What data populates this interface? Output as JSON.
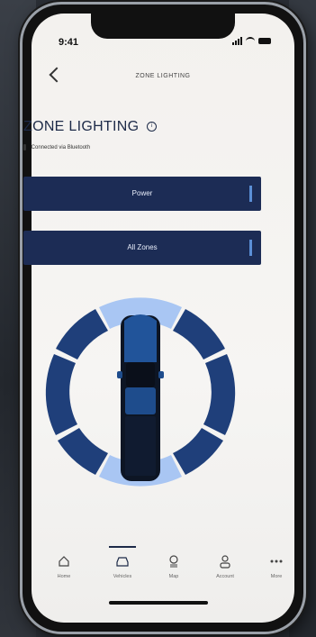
{
  "status": {
    "time": "9:41"
  },
  "header": {
    "title": "ZONE LIGHTING"
  },
  "main": {
    "title": "ZONE LIGHTING",
    "subtitle": "Connected via Bluetooth",
    "power_label": "Power",
    "zones_label": "All Zones"
  },
  "colors": {
    "accent": "#1c2c55",
    "ring": "#1f3f7a",
    "light": "#b9d4ff"
  },
  "tabbar": {
    "items": [
      {
        "label": "Home",
        "icon": "home-icon"
      },
      {
        "label": "Vehicles",
        "icon": "vehicle-icon"
      },
      {
        "label": "Map",
        "icon": "map-icon"
      },
      {
        "label": "Account",
        "icon": "account-icon"
      },
      {
        "label": "More",
        "icon": "more-icon"
      }
    ]
  }
}
